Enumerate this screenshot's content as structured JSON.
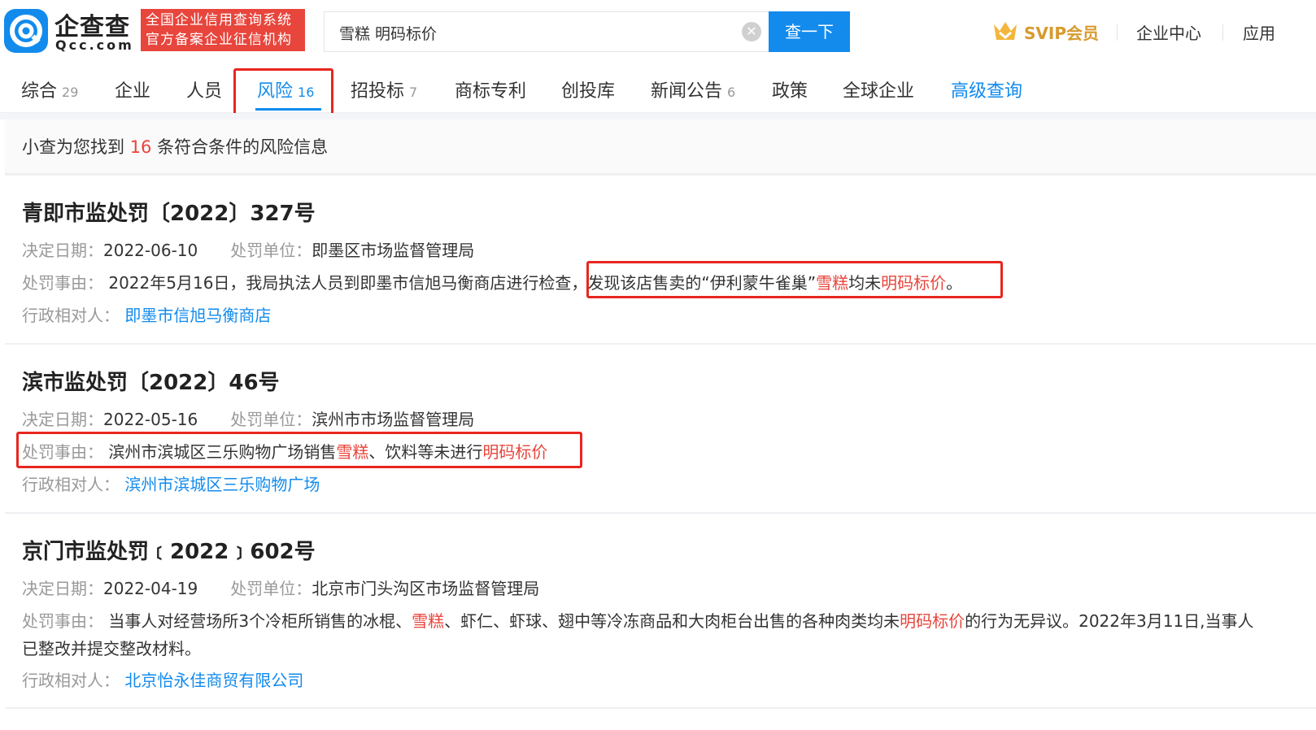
{
  "header": {
    "logo_cn": "企查查",
    "logo_en": "Qcc.com",
    "badge_line1": "全国企业信用查询系统",
    "badge_line2": "官方备案企业征信机构",
    "search_value": "雪糕 明码标价",
    "search_button": "查一下",
    "svip_label": "SVIP会员",
    "nav_enterprise": "企业中心",
    "nav_apps": "应用"
  },
  "tabs": [
    {
      "label": "综合",
      "count": "29"
    },
    {
      "label": "企业",
      "count": ""
    },
    {
      "label": "人员",
      "count": ""
    },
    {
      "label": "风险",
      "count": "16"
    },
    {
      "label": "招投标",
      "count": "7"
    },
    {
      "label": "商标专利",
      "count": ""
    },
    {
      "label": "创投库",
      "count": ""
    },
    {
      "label": "新闻公告",
      "count": "6"
    },
    {
      "label": "政策",
      "count": ""
    },
    {
      "label": "全球企业",
      "count": ""
    },
    {
      "label": "高级查询",
      "count": ""
    }
  ],
  "summary": {
    "prefix": "小查为您找到",
    "count": "16",
    "suffix": "条符合条件的风险信息"
  },
  "labels": {
    "date": "决定日期：",
    "unit": "处罚单位：",
    "reason": "处罚事由：",
    "party": "行政相对人："
  },
  "records": [
    {
      "title": "青即市监处罚〔2022〕327号",
      "date": "2022-06-10",
      "unit": "即墨区市场监督管理局",
      "reason_a": "2022年5月16日，我局执法人员到即墨市信旭马衡商店进行检查，",
      "reason_b": "发现该店售卖的“伊利蒙牛雀巢”",
      "reason_c": "雪糕",
      "reason_d": "均未",
      "reason_e": "明码标价",
      "reason_f": "。",
      "party": "即墨市信旭马衡商店"
    },
    {
      "title": "滨市监处罚〔2022〕46号",
      "date": "2022-05-16",
      "unit": "滨州市市场监督管理局",
      "reason_a": "滨州市滨城区三乐购物广场销售",
      "reason_b": "雪糕",
      "reason_c": "、饮料等未进行",
      "reason_d": "明码标价",
      "party": "滨州市滨城区三乐购物广场"
    },
    {
      "title": "京门市监处罚﹝2022﹞602号",
      "date": "2022-04-19",
      "unit": "北京市门头沟区市场监督管理局",
      "reason_a": "当事人对经营场所3个冷柜所销售的冰棍、",
      "reason_b": "雪糕",
      "reason_c": "、虾仁、虾球、翅中等冷冻商品和大肉柜台出售的各种肉类均未",
      "reason_d": "明码标价",
      "reason_e": "的行为无异议。2022年3月11日,当事人",
      "reason_line2": "已整改并提交整改材料。",
      "party": "北京怡永佳商贸有限公司"
    }
  ],
  "colors": {
    "brand": "#128bed",
    "alert": "#e8453c",
    "badge": "#e8453c",
    "svip": "#d79a2d"
  }
}
